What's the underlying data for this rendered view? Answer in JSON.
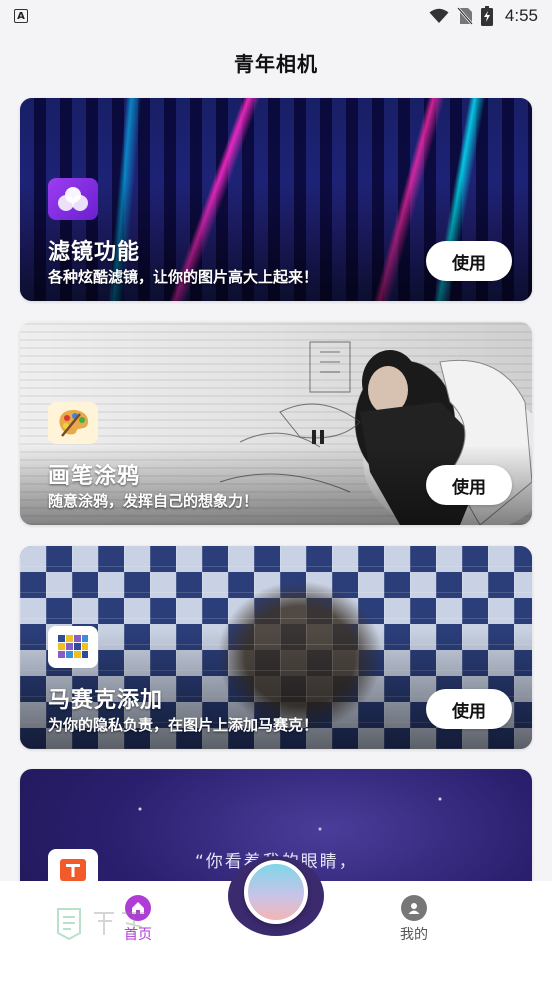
{
  "status_bar": {
    "time": "4:55",
    "left_icon": "a-notification-icon",
    "icons": [
      "wifi-icon",
      "no-sim-icon",
      "battery-icon"
    ]
  },
  "header": {
    "title": "青年相机"
  },
  "cards": [
    {
      "title": "滤镜功能",
      "subtitle": "各种炫酷滤镜，让你的图片高大上起来！",
      "button": "使用",
      "icon": "filter-circles-icon",
      "background": "neon-city"
    },
    {
      "title": "画笔涂鸦",
      "subtitle": "随意涂鸦，发挥自己的想象力！",
      "button": "使用",
      "icon": "palette-icon",
      "background": "sketch-portrait"
    },
    {
      "title": "马赛克添加",
      "subtitle": "为你的隐私负责，在图片上添加马赛克！",
      "button": "使用",
      "icon": "mosaic-grid-icon",
      "background": "mosaic-tiles"
    },
    {
      "title": "",
      "subtitle": "",
      "quote": "“你看着我的眼睛，",
      "icon": "text-t-icon",
      "background": "night-sky"
    }
  ],
  "bottom_nav": {
    "home_label": "首页",
    "mine_label": "我的",
    "camera_icon": "camera-shutter-icon"
  },
  "colors": {
    "accent": "#b03cd8",
    "card_button_bg": "#ffffff",
    "camera_ring": "#3b2a6e"
  }
}
